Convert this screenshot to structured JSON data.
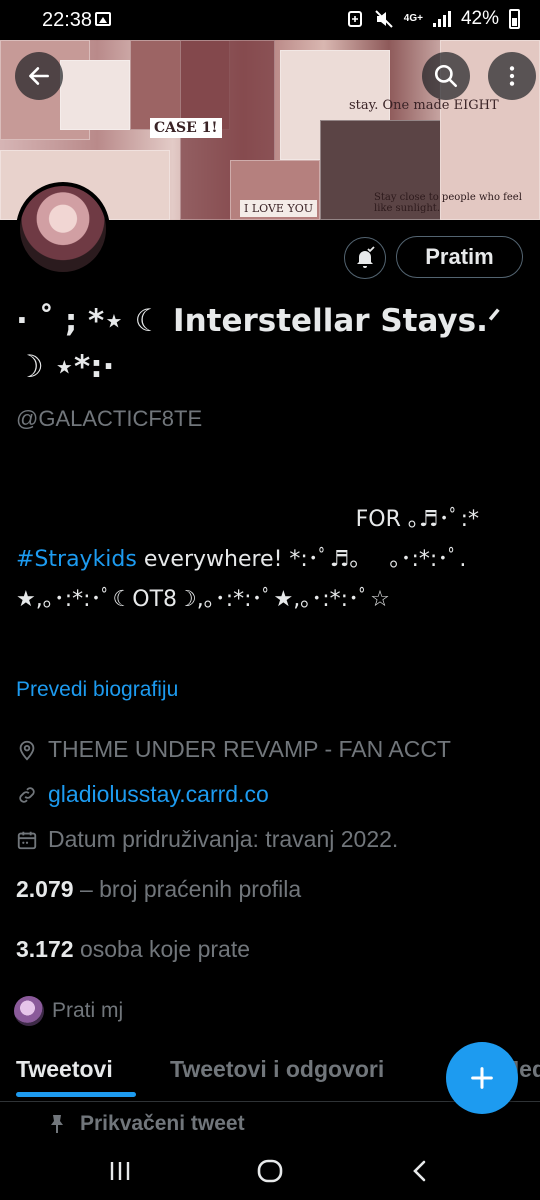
{
  "status_bar": {
    "time": "22:38",
    "network": "4G+",
    "battery": "42%"
  },
  "header": {
    "back_icon": "arrow-left-icon",
    "search_icon": "search-icon",
    "more_icon": "more-vertical-icon"
  },
  "profile": {
    "name": "· ˚ ; *⋆ ☾ Interstellar Stays.ᐟ ☽ ⋆*:·",
    "handle": "@GALACTICF8TE",
    "follow_label": "Pratim",
    "bio": {
      "line1": "FOR ｡♬･ﾟ:*",
      "hashtag": "#Straykids",
      "line2_rest": " everywhere! *:･ﾟ♬｡ 　｡･:*:･ﾟ.",
      "line3": "★,｡･:*:･ﾟ☾OT8☽,｡･:*:･ﾟ★,｡･:*:･ﾟ☆"
    },
    "translate_label": "Prevedi biografiju",
    "location": "THEME UNDER REVAMP - FAN ACCT",
    "website": "gladiolusstay.carrd.co",
    "joined": "Datum pridruživanja: travanj 2022.",
    "following_count": "2.079",
    "following_label": " – broj praćenih profila",
    "followers_count": "3.172",
    "followers_label": " osoba koje prate",
    "followed_by": "Prati mj"
  },
  "banner": {
    "case_text": "CASE 1!",
    "love_text": "I LOVE YOU",
    "stay_text": "stay. One made EIGHT",
    "quote_text": "Stay close to people who feel like sunlight."
  },
  "tabs": [
    {
      "label": "Tweetovi",
      "active": true
    },
    {
      "label": "Tweetovi i odgovori",
      "active": false
    },
    {
      "label": "Medijski",
      "active": false
    }
  ],
  "pinned_label": "Prikvačeni tweet",
  "colors": {
    "accent": "#1d9bf0",
    "background": "#000000",
    "text_primary": "#e7e9ea",
    "text_secondary": "#71767b"
  }
}
